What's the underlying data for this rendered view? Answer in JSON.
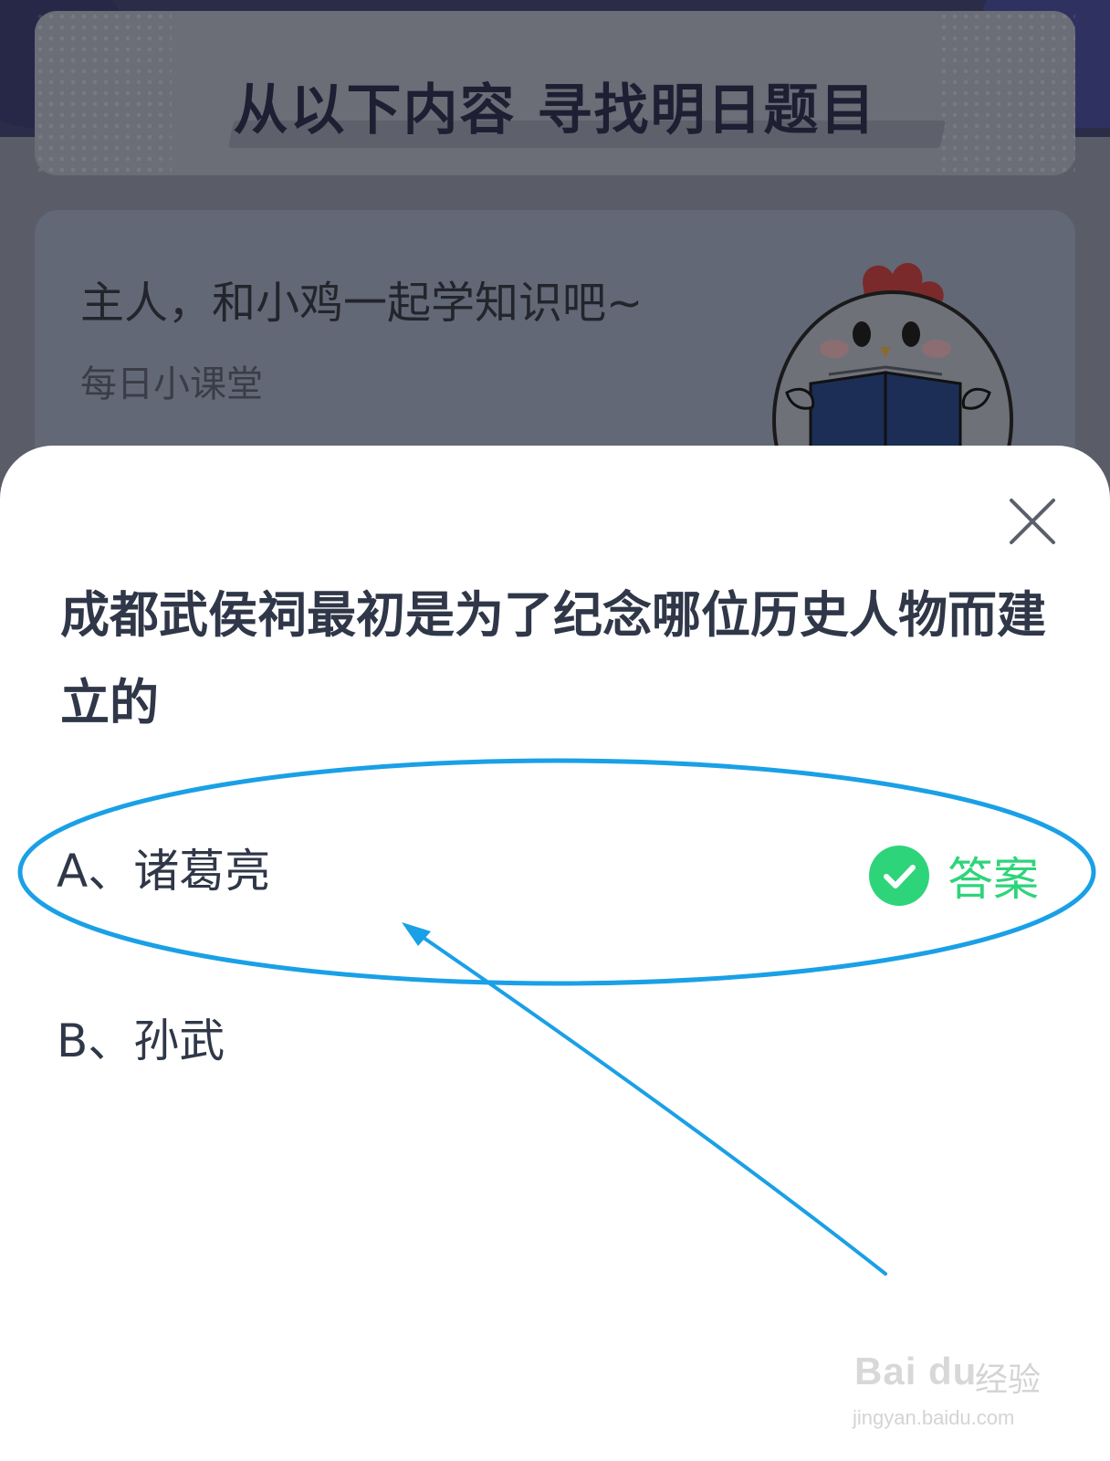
{
  "background": {
    "banner_title": "从以下内容  寻找明日题目",
    "lesson_card": {
      "title": "主人，和小鸡一起学知识吧~",
      "subtitle": "每日小课堂"
    }
  },
  "sheet": {
    "question": "成都武侯祠最初是为了纪念哪位历史人物而建立的",
    "options": [
      {
        "label": "A、诸葛亮",
        "is_answer": true
      },
      {
        "label": "B、孙武",
        "is_answer": false
      }
    ],
    "answer_tag": "答案",
    "close_icon": "close-icon",
    "answer_icon": "check-circle-icon"
  },
  "annotation": {
    "color": "#1aa0e6",
    "shapes": [
      "ellipse-highlight",
      "arrow"
    ]
  },
  "watermark": {
    "logo": "Bai du",
    "brand": "经验",
    "url": "jingyan.baidu.com"
  },
  "colors": {
    "answer_green": "#2ed47a",
    "text_dark": "#2f3748",
    "overlay": "#5a5d68"
  }
}
